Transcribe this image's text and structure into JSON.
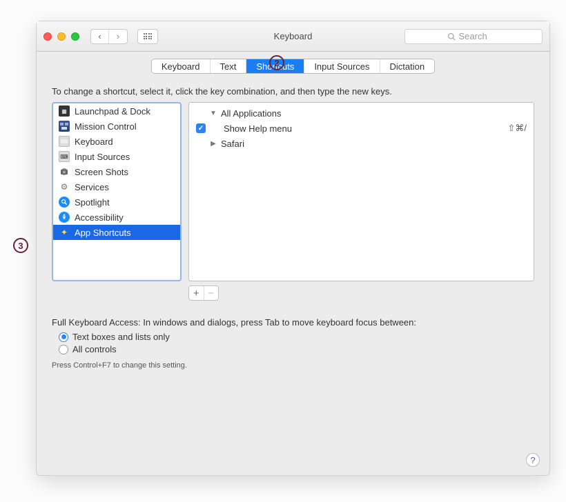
{
  "window": {
    "title": "Keyboard"
  },
  "search": {
    "placeholder": "Search"
  },
  "tabs": [
    {
      "label": "Keyboard",
      "active": false
    },
    {
      "label": "Text",
      "active": false
    },
    {
      "label": "Shortcuts",
      "active": true
    },
    {
      "label": "Input Sources",
      "active": false
    },
    {
      "label": "Dictation",
      "active": false
    }
  ],
  "instruction": "To change a shortcut, select it, click the key combination, and then type the new keys.",
  "categories": [
    {
      "label": "Launchpad & Dock",
      "icon": "launchpad-icon"
    },
    {
      "label": "Mission Control",
      "icon": "mission-control-icon"
    },
    {
      "label": "Keyboard",
      "icon": "keyboard-icon"
    },
    {
      "label": "Input Sources",
      "icon": "input-sources-icon"
    },
    {
      "label": "Screen Shots",
      "icon": "screenshots-icon"
    },
    {
      "label": "Services",
      "icon": "services-icon"
    },
    {
      "label": "Spotlight",
      "icon": "spotlight-icon"
    },
    {
      "label": "Accessibility",
      "icon": "accessibility-icon"
    },
    {
      "label": "App Shortcuts",
      "icon": "app-shortcuts-icon",
      "selected": true
    }
  ],
  "details": {
    "group1": {
      "label": "All Applications"
    },
    "item1": {
      "label": "Show Help menu",
      "shortcut": "⇧⌘/"
    },
    "group2": {
      "label": "Safari"
    }
  },
  "fka": {
    "title": "Full Keyboard Access: In windows and dialogs, press Tab to move keyboard focus between:",
    "option1": "Text boxes and lists only",
    "option2": "All controls",
    "hint": "Press Control+F7 to change this setting."
  },
  "annotations": {
    "two": "2",
    "three": "3"
  }
}
